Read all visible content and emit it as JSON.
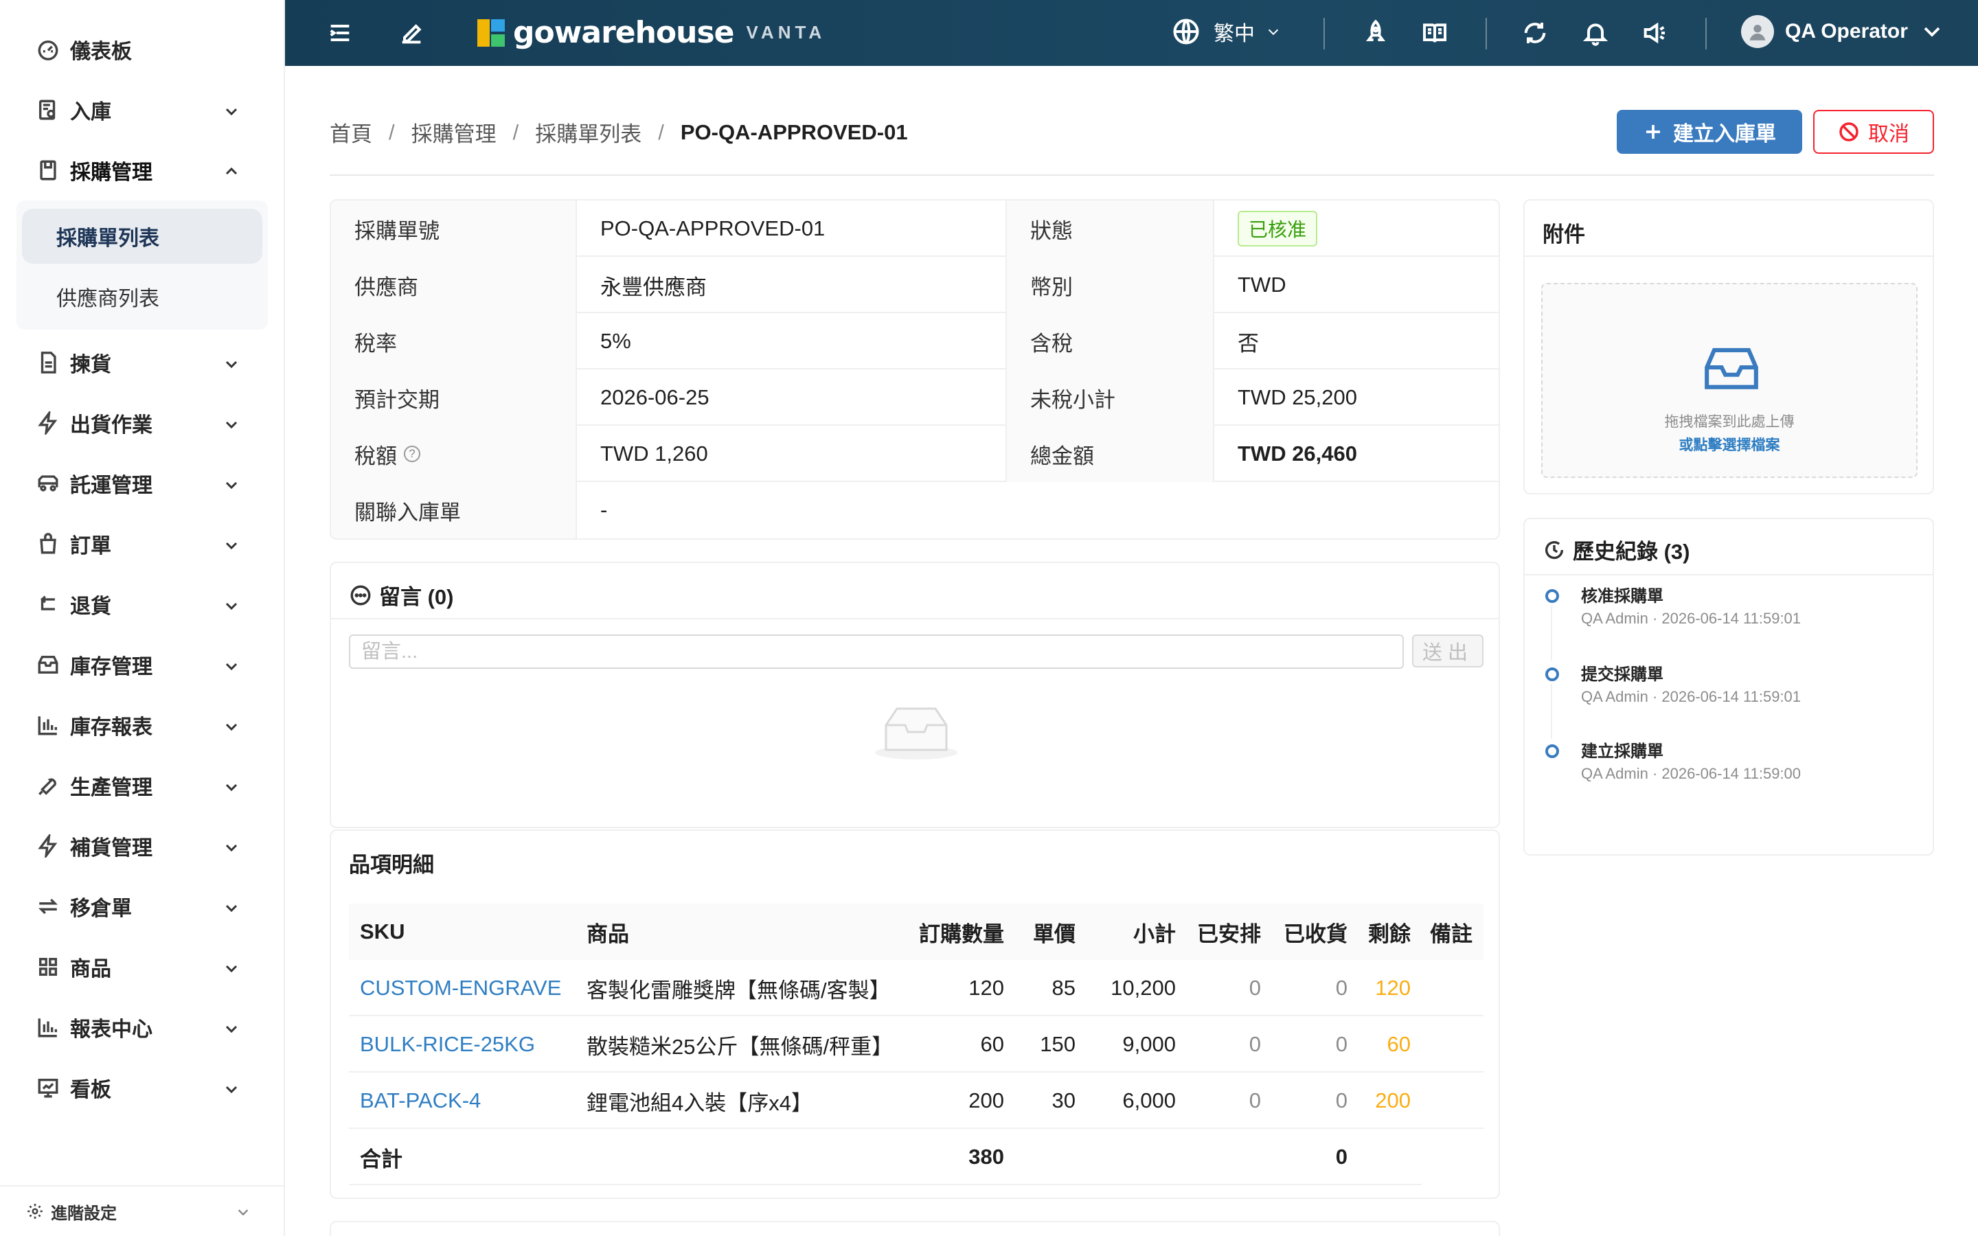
{
  "sidebar": {
    "items": [
      {
        "label": "儀表板",
        "icon": "dashboard-icon"
      },
      {
        "label": "入庫",
        "icon": "inbound-icon"
      },
      {
        "label": "採購管理",
        "icon": "purchase-icon"
      },
      {
        "label": "揀貨",
        "icon": "picking-icon"
      },
      {
        "label": "出貨作業",
        "icon": "shipping-icon"
      },
      {
        "label": "託運管理",
        "icon": "truck-icon"
      },
      {
        "label": "訂單",
        "icon": "order-bag-icon"
      },
      {
        "label": "退貨",
        "icon": "return-icon"
      },
      {
        "label": "庫存管理",
        "icon": "inventory-icon"
      },
      {
        "label": "庫存報表",
        "icon": "bar-chart-icon"
      },
      {
        "label": "生產管理",
        "icon": "wrench-icon"
      },
      {
        "label": "補貨管理",
        "icon": "lightning-icon"
      },
      {
        "label": "移倉單",
        "icon": "transfer-icon"
      },
      {
        "label": "商品",
        "icon": "grid-icon"
      },
      {
        "label": "報表中心",
        "icon": "report-icon"
      },
      {
        "label": "看板",
        "icon": "board-icon"
      }
    ],
    "sub_items": [
      {
        "label": "採購單列表",
        "selected": true
      },
      {
        "label": "供應商列表",
        "selected": false
      }
    ],
    "footer_label": "進階設定"
  },
  "topbar": {
    "logo_text": "gowarehouse",
    "logo_sub": "VANTA",
    "language": "繁中",
    "user_name": "QA Operator"
  },
  "breadcrumb": [
    "首頁",
    "採購管理",
    "採購單列表",
    "PO-QA-APPROVED-01"
  ],
  "actions": {
    "create_inbound": "建立入庫單",
    "cancel": "取消"
  },
  "detail": {
    "po_number_label": "採購單號",
    "po_number": "PO-QA-APPROVED-01",
    "status_label": "狀態",
    "status": "已核准",
    "supplier_label": "供應商",
    "supplier": "永豐供應商",
    "currency_label": "幣別",
    "currency": "TWD",
    "tax_rate_label": "稅率",
    "tax_rate": "5%",
    "tax_included_label": "含稅",
    "tax_included": "否",
    "expected_date_label": "預計交期",
    "expected_date": "2026-06-25",
    "subtotal_label": "未稅小計",
    "subtotal": "TWD 25,200",
    "tax_label": "稅額",
    "tax_help": "?",
    "tax": "TWD 1,260",
    "total_label": "總金額",
    "total": "TWD 26,460",
    "related_inbound_label": "關聯入庫單",
    "related_inbound": "-"
  },
  "comments": {
    "title": "留言 (0)",
    "placeholder": "留言...",
    "send_label": "送出"
  },
  "items": {
    "title": "品項明細",
    "columns": [
      "SKU",
      "商品",
      "訂購數量",
      "單價",
      "小計",
      "已安排",
      "已收貨",
      "剩餘",
      "備註"
    ],
    "rows": [
      {
        "sku": "CUSTOM-ENGRAVE",
        "name": "客製化雷雕獎牌【無條碼/客製】",
        "qty": "120",
        "price": "85",
        "subtotal": "10,200",
        "arranged": "0",
        "received": "0",
        "remaining": "120",
        "note": ""
      },
      {
        "sku": "BULK-RICE-25KG",
        "name": "散裝糙米25公斤【無條碼/秤重】",
        "qty": "60",
        "price": "150",
        "subtotal": "9,000",
        "arranged": "0",
        "received": "0",
        "remaining": "60",
        "note": ""
      },
      {
        "sku": "BAT-PACK-4",
        "name": "鋰電池組4入裝【序x4】",
        "qty": "200",
        "price": "30",
        "subtotal": "6,000",
        "arranged": "0",
        "received": "0",
        "remaining": "200",
        "note": ""
      }
    ],
    "total_label": "合計",
    "total_qty": "380",
    "total_received": "0"
  },
  "attachments": {
    "title": "附件",
    "drop_text": "拖拽檔案到此處上傳",
    "select_text": "或點擊選擇檔案"
  },
  "history": {
    "title": "歷史紀錄 (3)",
    "entries": [
      {
        "title": "核准採購單",
        "meta": "QA Admin · 2026-06-14 11:59:01"
      },
      {
        "title": "提交採購單",
        "meta": "QA Admin · 2026-06-14 11:59:01"
      },
      {
        "title": "建立採購單",
        "meta": "QA Admin · 2026-06-14 11:59:00"
      }
    ]
  },
  "colors": {
    "topbar": "#1c4863",
    "primary": "#3a7bbf",
    "danger": "#f5222d",
    "success": "#389e0d",
    "warning": "#faad14",
    "link": "#2f7ec3"
  }
}
